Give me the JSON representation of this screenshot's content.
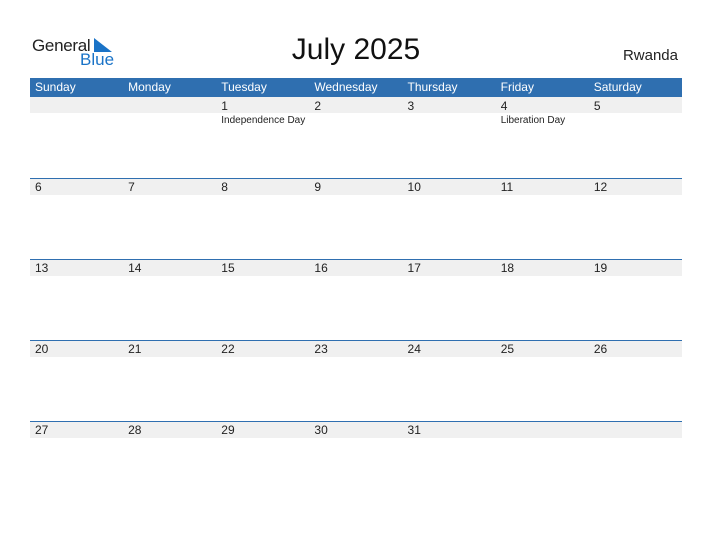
{
  "logo": {
    "general": "General",
    "blue": "Blue"
  },
  "title": "July 2025",
  "country": "Rwanda",
  "colors": {
    "header_bg": "#2f6fb0",
    "day_bar_bg": "#f0f0f0",
    "logo_blue": "#1a73c7"
  },
  "weekdays": [
    "Sunday",
    "Monday",
    "Tuesday",
    "Wednesday",
    "Thursday",
    "Friday",
    "Saturday"
  ],
  "weeks": [
    [
      {
        "day": "",
        "holiday": ""
      },
      {
        "day": "",
        "holiday": ""
      },
      {
        "day": "1",
        "holiday": "Independence Day"
      },
      {
        "day": "2",
        "holiday": ""
      },
      {
        "day": "3",
        "holiday": ""
      },
      {
        "day": "4",
        "holiday": "Liberation Day"
      },
      {
        "day": "5",
        "holiday": ""
      }
    ],
    [
      {
        "day": "6",
        "holiday": ""
      },
      {
        "day": "7",
        "holiday": ""
      },
      {
        "day": "8",
        "holiday": ""
      },
      {
        "day": "9",
        "holiday": ""
      },
      {
        "day": "10",
        "holiday": ""
      },
      {
        "day": "11",
        "holiday": ""
      },
      {
        "day": "12",
        "holiday": ""
      }
    ],
    [
      {
        "day": "13",
        "holiday": ""
      },
      {
        "day": "14",
        "holiday": ""
      },
      {
        "day": "15",
        "holiday": ""
      },
      {
        "day": "16",
        "holiday": ""
      },
      {
        "day": "17",
        "holiday": ""
      },
      {
        "day": "18",
        "holiday": ""
      },
      {
        "day": "19",
        "holiday": ""
      }
    ],
    [
      {
        "day": "20",
        "holiday": ""
      },
      {
        "day": "21",
        "holiday": ""
      },
      {
        "day": "22",
        "holiday": ""
      },
      {
        "day": "23",
        "holiday": ""
      },
      {
        "day": "24",
        "holiday": ""
      },
      {
        "day": "25",
        "holiday": ""
      },
      {
        "day": "26",
        "holiday": ""
      }
    ],
    [
      {
        "day": "27",
        "holiday": ""
      },
      {
        "day": "28",
        "holiday": ""
      },
      {
        "day": "29",
        "holiday": ""
      },
      {
        "day": "30",
        "holiday": ""
      },
      {
        "day": "31",
        "holiday": ""
      },
      {
        "day": "",
        "holiday": ""
      },
      {
        "day": "",
        "holiday": ""
      }
    ]
  ]
}
